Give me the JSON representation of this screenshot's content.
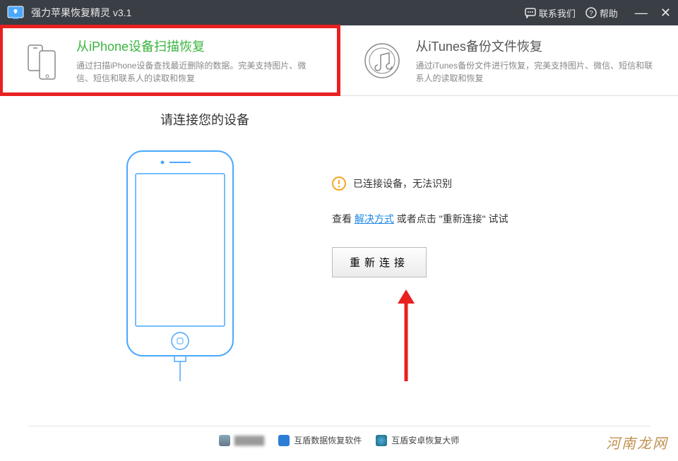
{
  "titlebar": {
    "title": "强力苹果恢复精灵 v3.1",
    "contact": "联系我们",
    "help": "帮助"
  },
  "modes": {
    "iphone": {
      "title": "从iPhone设备扫描恢复",
      "desc": "通过扫描iPhone设备查找最近删除的数据。完美支持图片、微信、短信和联系人的读取和恢复"
    },
    "itunes": {
      "title": "从iTunes备份文件恢复",
      "desc": "通过iTunes备份文件进行恢复，完美支持图片、微信、短信和联系人的读取和恢复"
    }
  },
  "main": {
    "heading": "请连接您的设备",
    "status": "已连接设备，无法识别",
    "suggestion_prefix": "查看 ",
    "suggestion_link": "解决方式",
    "suggestion_middle": " 或者点击 \"重新连接\" 试试",
    "reconnect": "重新连接"
  },
  "footer": {
    "item2": "互盾数据恢复软件",
    "item3": "互盾安卓恢复大师"
  },
  "watermark": "河南龙网",
  "colors": {
    "accent_green": "#3bb53f",
    "highlight_red": "#e82020",
    "link_blue": "#1e88e5"
  }
}
